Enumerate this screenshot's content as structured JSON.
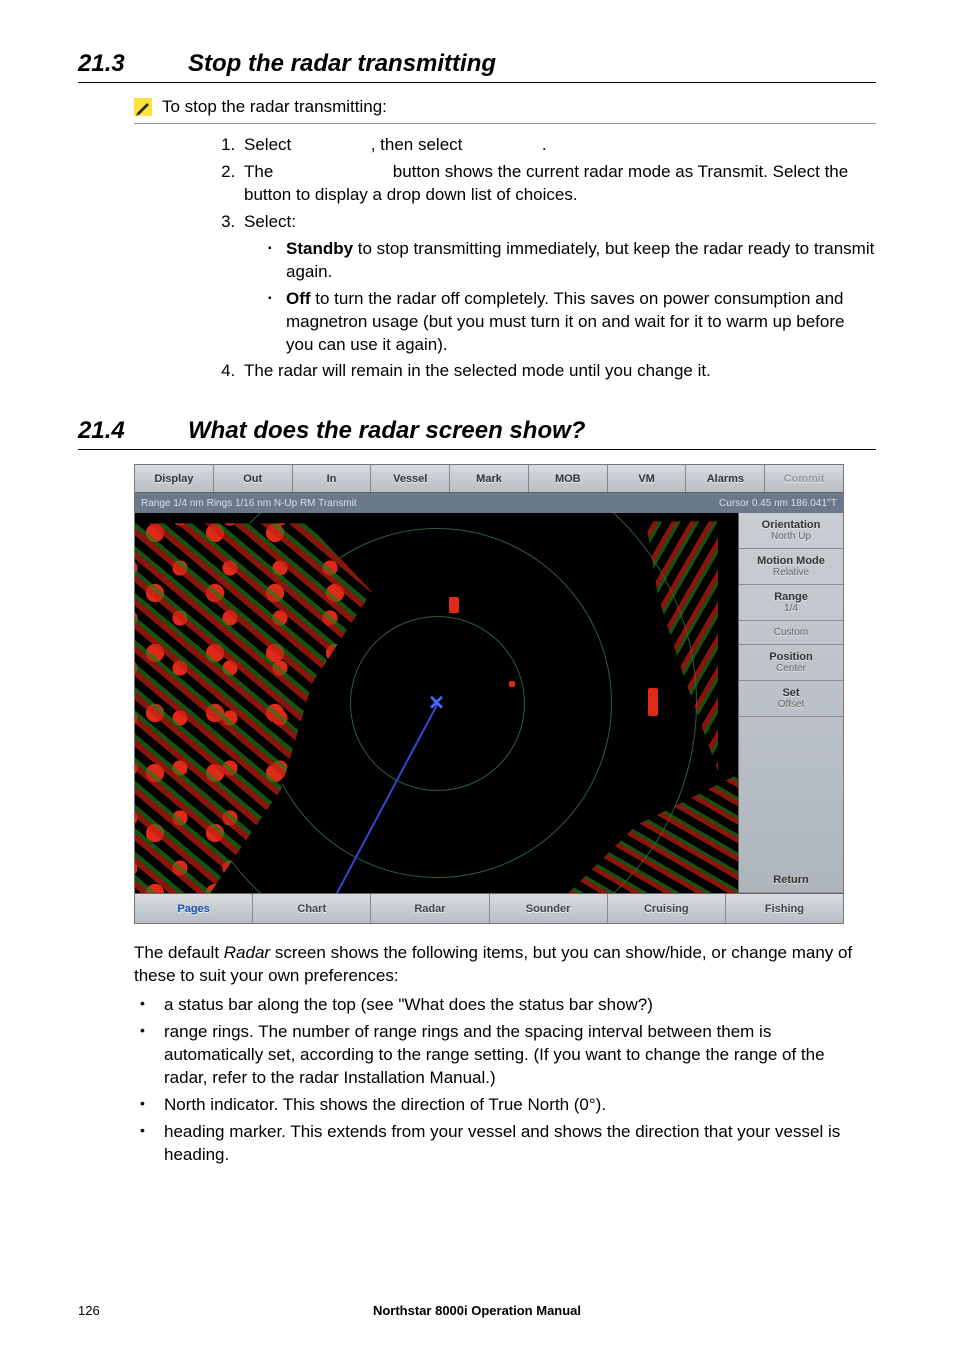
{
  "section1": {
    "num": "21.3",
    "title": "Stop the radar transmitting",
    "procTitle": "To stop the radar transmitting:",
    "steps": {
      "s1a": "Select ",
      "s1b": ", then select ",
      "s1c": ".",
      "s2a": "The ",
      "s2b": " button shows the current radar mode as Transmit. Select the button to display a drop down list of choices.",
      "s3": "Select:",
      "s3b1a": "Standby",
      "s3b1b": " to stop transmitting immediately, but keep the radar ready to transmit again.",
      "s3b2a": "Off",
      "s3b2b": " to turn the radar off completely. This saves on power consumption and magnetron usage (but you must turn it on and wait for it to warm up before you can use it again).",
      "s4": "The radar will remain in the selected mode until you change it."
    }
  },
  "section2": {
    "num": "21.4",
    "title": "What does the radar screen show?"
  },
  "screenshot": {
    "top": [
      "Display",
      "Out",
      "In",
      "Vessel",
      "Mark",
      "MOB",
      "VM",
      "Alarms",
      "Commit"
    ],
    "statusL": "Range 1/4 nm  Rings 1/16 nm   N-Up   RM   Transmit",
    "statusR": "Cursor 0.45 nm 186.041°T",
    "side": [
      {
        "t1": "Orientation",
        "t2": "North Up"
      },
      {
        "t1": "Motion Mode",
        "t2": "Relative"
      },
      {
        "t1": "Range",
        "t2": "1/4"
      },
      {
        "t1": "",
        "t2": "Custom"
      },
      {
        "t1": "Position",
        "t2": "Center"
      },
      {
        "t1": "Set",
        "t2": "Offset"
      }
    ],
    "sideReturn": "Return",
    "bottom": [
      "Pages",
      "Chart",
      "Radar",
      "Sounder",
      "Cruising",
      "Fishing"
    ]
  },
  "body": {
    "p1a": "The default ",
    "p1b": "Radar",
    "p1c": " screen shows the following items, but you can show/hide, or change many of these to suit your own preferences:",
    "li1": "a status bar along the top (see \"What does the status bar show?)",
    "li2": "range rings. The number of range rings and the spacing interval between them is automatically set, according to the range setting. (If you want to change the range of the radar, refer to the radar Installation Manual.)",
    "li3": "North indicator. This shows the direction of True North (0°).",
    "li4": "heading marker. This extends from your vessel and shows the direction that your vessel is heading."
  },
  "footer": {
    "page": "126",
    "title": "Northstar 8000i Operation Manual"
  }
}
